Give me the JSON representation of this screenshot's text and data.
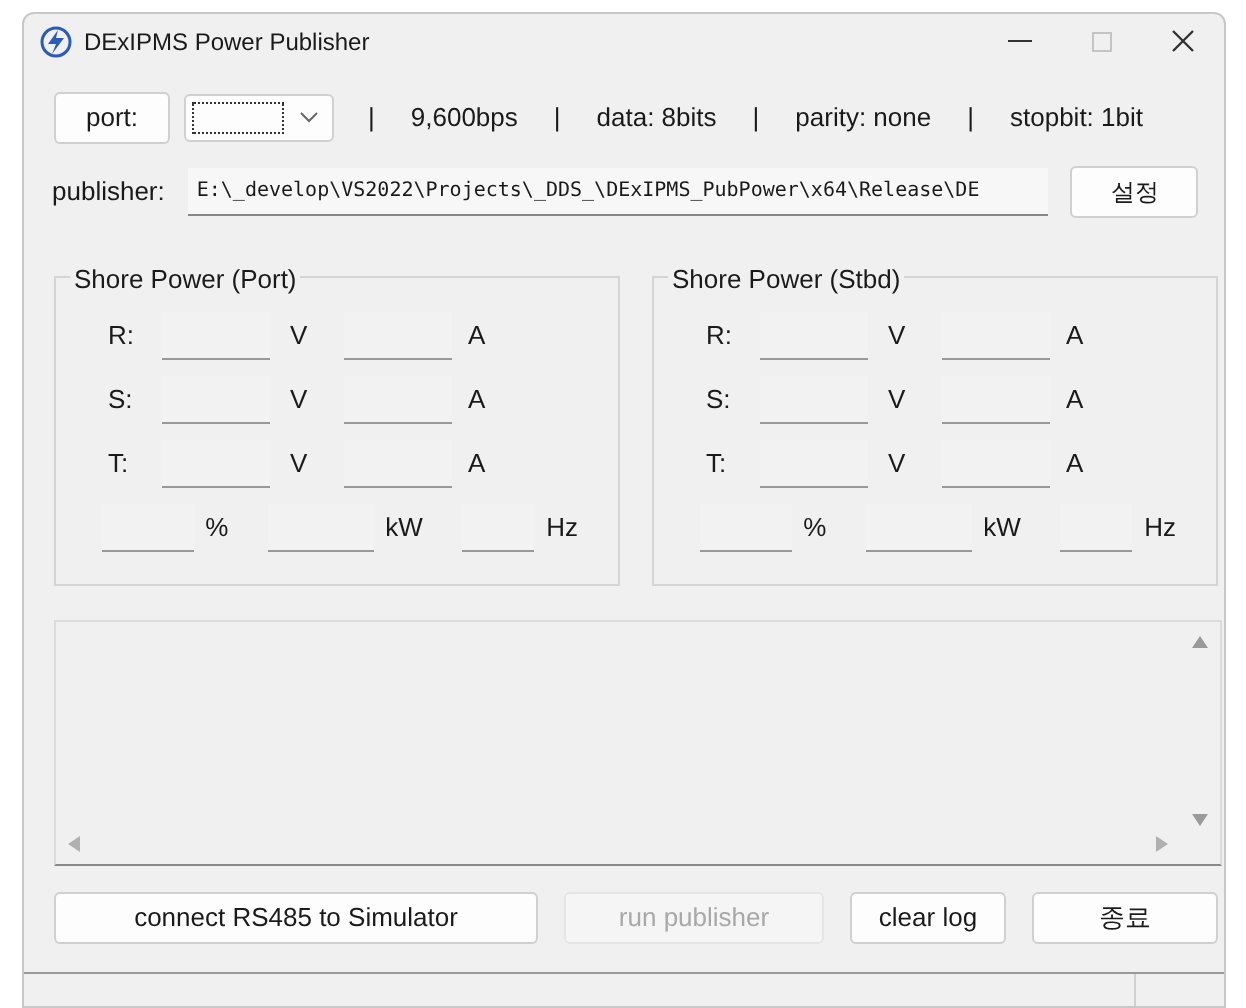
{
  "window": {
    "title": "DExIPMS Power Publisher"
  },
  "serial": {
    "port_button": "port:",
    "port_combo": {
      "value_selected": true
    },
    "settings": [
      "|",
      "9,600bps",
      "|",
      "data: 8bits",
      "|",
      "parity: none",
      "|",
      "stopbit: 1bit"
    ]
  },
  "publisher": {
    "label": "publisher:",
    "path": "E:\\_develop\\VS2022\\Projects\\_DDS_\\DExIPMS_PubPower\\x64\\Release\\DE",
    "button": "설정"
  },
  "groups": [
    {
      "title": "Shore Power (Port)",
      "phases": [
        {
          "label": "R:",
          "voltage_unit": "V",
          "current_unit": "A"
        },
        {
          "label": "S:",
          "voltage_unit": "V",
          "current_unit": "A"
        },
        {
          "label": "T:",
          "voltage_unit": "V",
          "current_unit": "A"
        }
      ],
      "summary": [
        "%",
        "kW",
        "Hz"
      ]
    },
    {
      "title": "Shore Power (Stbd)",
      "phases": [
        {
          "label": "R:",
          "voltage_unit": "V",
          "current_unit": "A"
        },
        {
          "label": "S:",
          "voltage_unit": "V",
          "current_unit": "A"
        },
        {
          "label": "T:",
          "voltage_unit": "V",
          "current_unit": "A"
        }
      ],
      "summary": [
        "%",
        "kW",
        "Hz"
      ]
    }
  ],
  "buttons": [
    {
      "label": "connect RS485 to Simulator",
      "disabled": false
    },
    {
      "label": "run publisher",
      "disabled": true
    },
    {
      "label": "clear log",
      "disabled": false
    },
    {
      "label": "종료",
      "disabled": false
    }
  ]
}
